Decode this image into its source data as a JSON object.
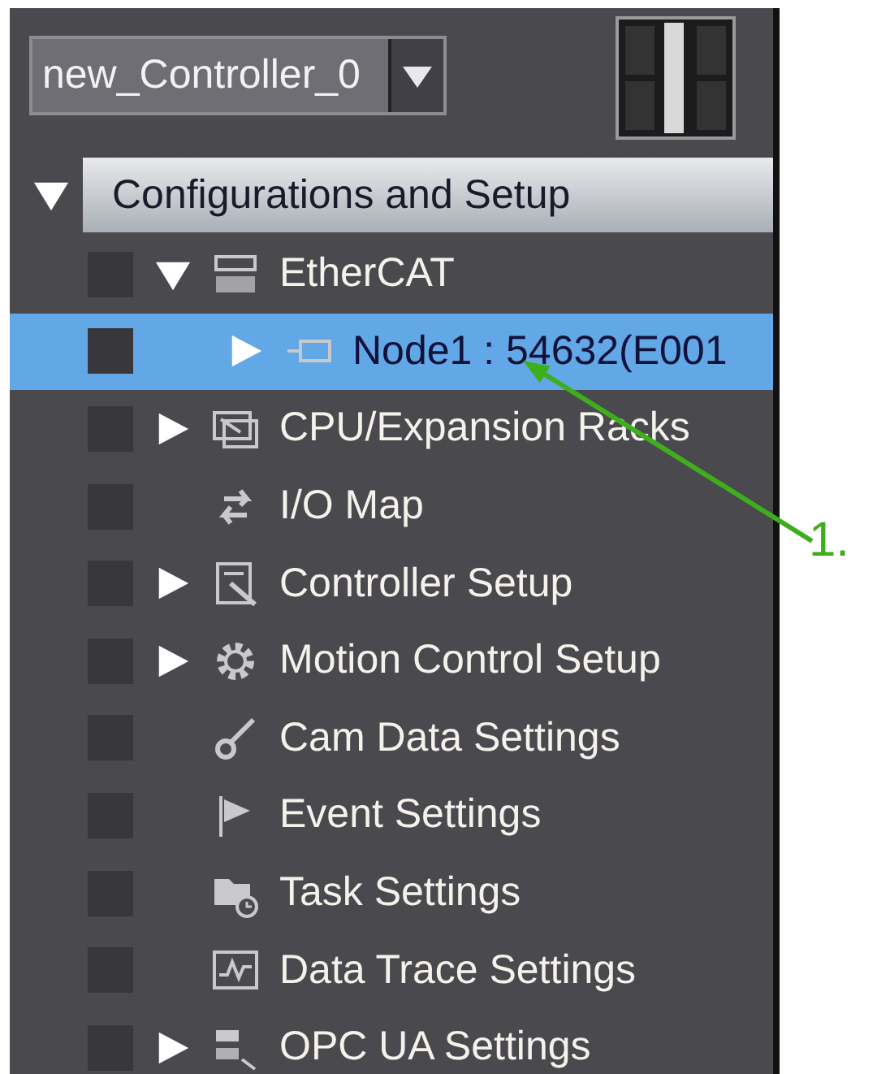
{
  "controller_selector": {
    "value": "new_Controller_0"
  },
  "section": {
    "title": "Configurations and Setup",
    "expanded": true,
    "items": [
      {
        "label": "EtherCAT",
        "kind": "ethercat",
        "expandable": true,
        "expanded": true,
        "selected": false,
        "children": [
          {
            "label": "Node1 : 54632(E001",
            "kind": "node",
            "expandable": true,
            "expanded": false,
            "selected": true
          }
        ]
      },
      {
        "label": "CPU/Expansion Racks",
        "kind": "rack",
        "expandable": true,
        "expanded": false,
        "selected": false
      },
      {
        "label": "I/O Map",
        "kind": "io-map",
        "expandable": false,
        "selected": false
      },
      {
        "label": "Controller Setup",
        "kind": "controller",
        "expandable": true,
        "expanded": false,
        "selected": false
      },
      {
        "label": "Motion Control Setup",
        "kind": "motion",
        "expandable": true,
        "expanded": false,
        "selected": false
      },
      {
        "label": "Cam Data Settings",
        "kind": "cam",
        "expandable": false,
        "selected": false
      },
      {
        "label": "Event Settings",
        "kind": "event",
        "expandable": false,
        "selected": false
      },
      {
        "label": "Task Settings",
        "kind": "task",
        "expandable": false,
        "selected": false
      },
      {
        "label": "Data Trace Settings",
        "kind": "trace",
        "expandable": false,
        "selected": false
      },
      {
        "label": "OPC UA Settings",
        "kind": "opc",
        "expandable": true,
        "expanded": false,
        "selected": false
      }
    ]
  },
  "callout": {
    "label": "1."
  }
}
